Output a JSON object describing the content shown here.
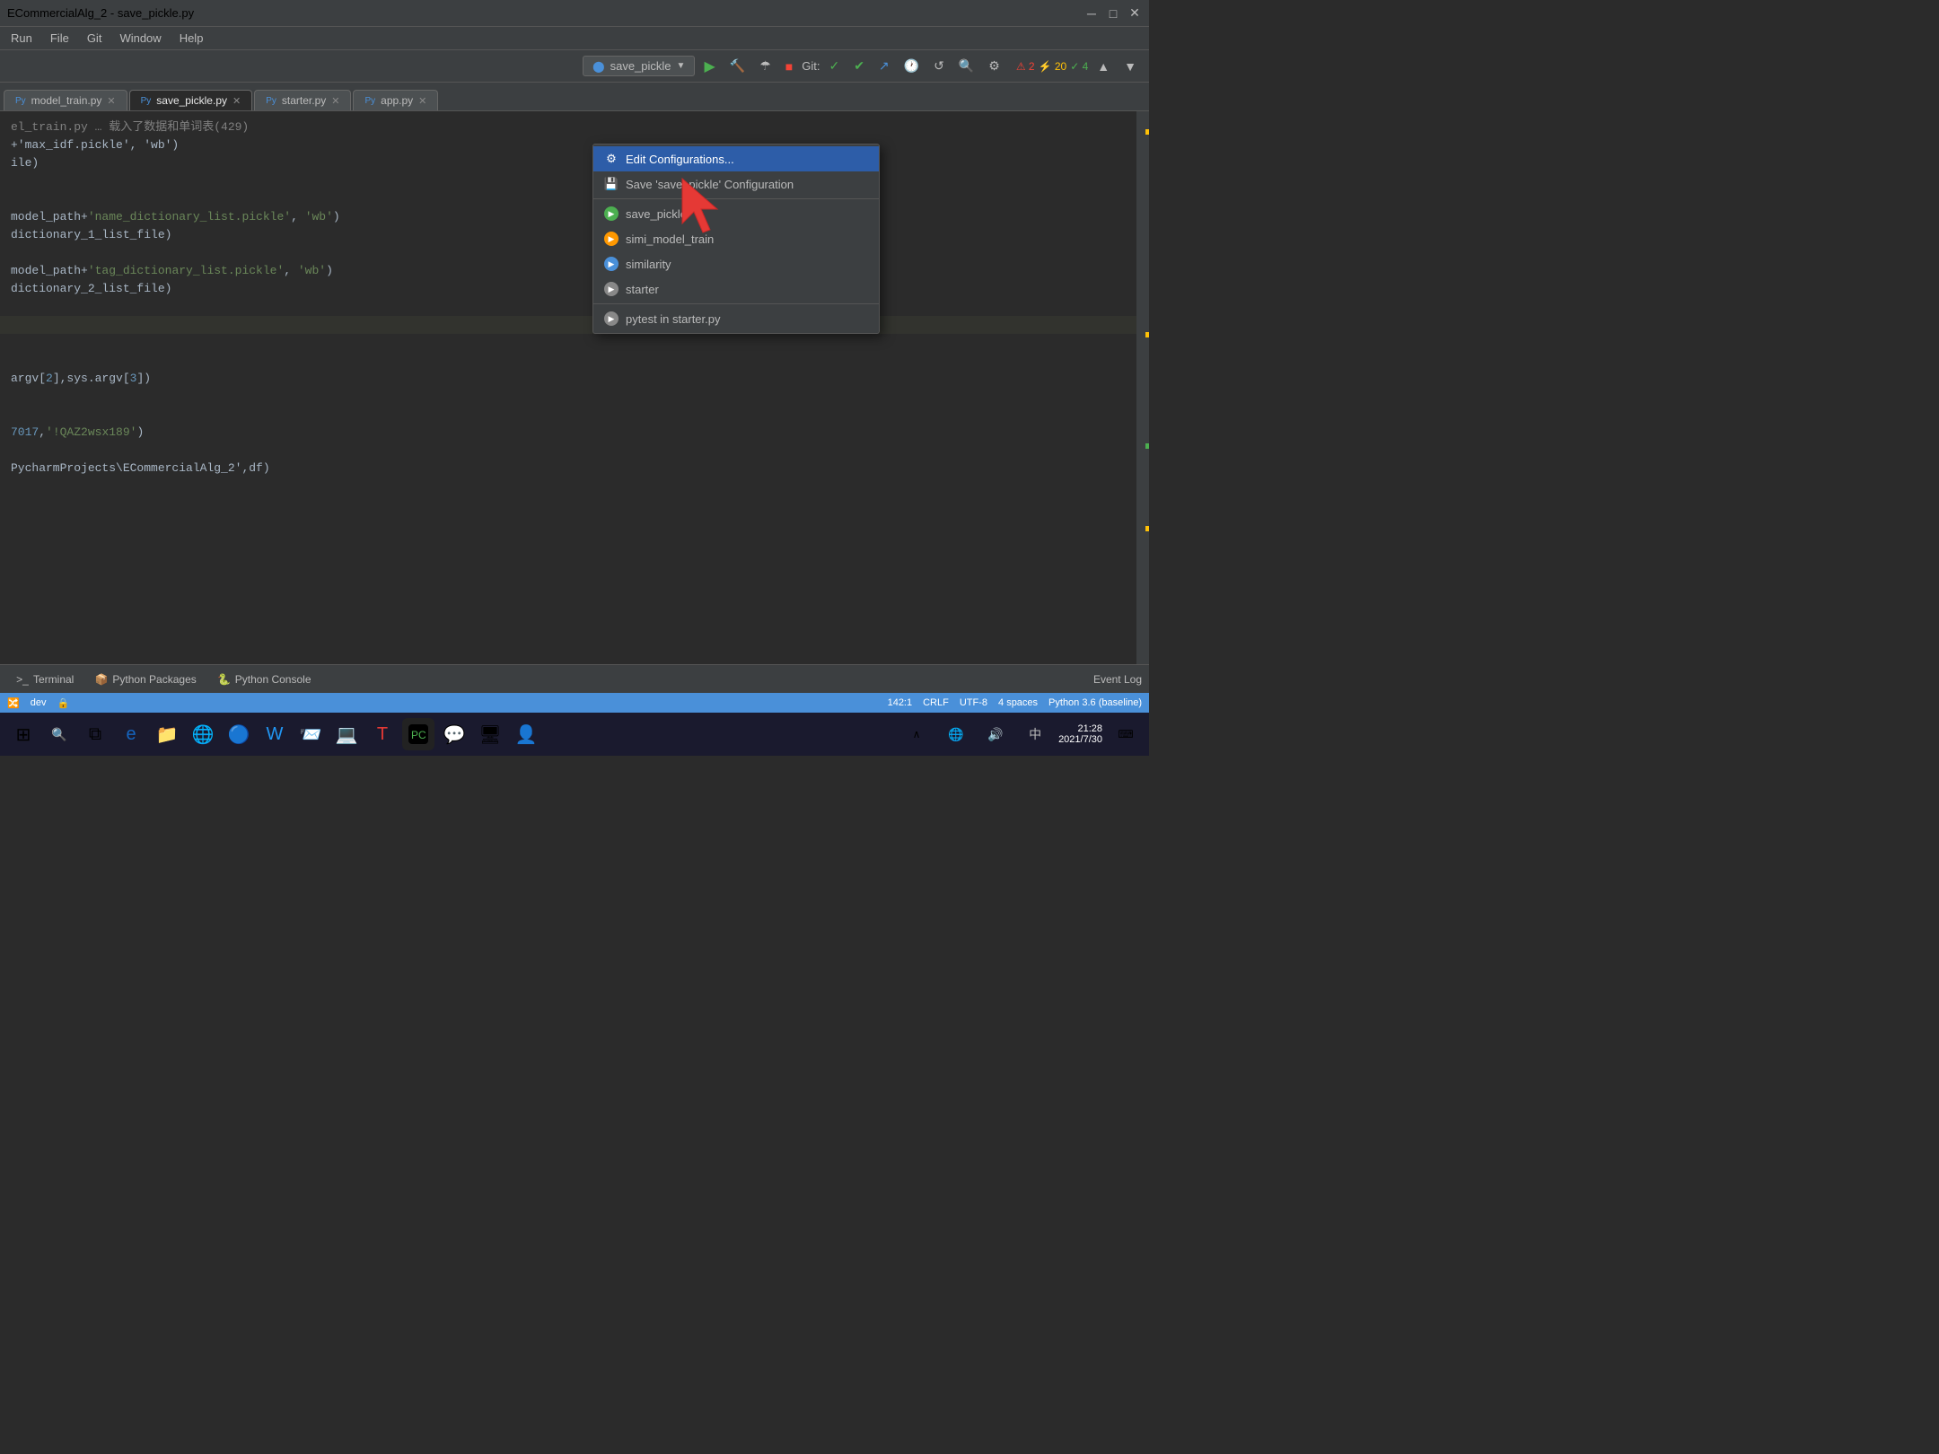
{
  "window": {
    "title": "ECommercialAlg_2 - save_pickle.py",
    "tab_title": "save_pickle.py"
  },
  "menu": {
    "items": [
      "Run",
      "File",
      "Git",
      "Window",
      "Help"
    ]
  },
  "toolbar": {
    "run_config": "save_pickle",
    "git_label": "Git:",
    "warnings": "⚠ 2",
    "errors": "⚡ 20",
    "ok": "✓ 4"
  },
  "tabs": [
    {
      "label": "model_train.py",
      "closable": true
    },
    {
      "label": "save_pickle.py",
      "closable": true,
      "active": true
    },
    {
      "label": "starter.py",
      "closable": true
    },
    {
      "label": "app.py",
      "closable": true
    }
  ],
  "dropdown": {
    "items": [
      {
        "type": "action",
        "label": "Edit Configurations...",
        "icon": "gear",
        "selected": true
      },
      {
        "type": "action",
        "label": "Save 'save_pickle' Configuration",
        "icon": "save"
      },
      {
        "type": "divider"
      },
      {
        "type": "config",
        "label": "save_pickle",
        "icon": "run-green"
      },
      {
        "type": "config",
        "label": "simi_model_train",
        "icon": "run-orange"
      },
      {
        "type": "config",
        "label": "similarity",
        "icon": "run-blue"
      },
      {
        "type": "config",
        "label": "starter",
        "icon": "run-grey"
      },
      {
        "type": "divider"
      },
      {
        "type": "config",
        "label": "pytest in starter.py",
        "icon": "run-grey"
      }
    ]
  },
  "code_lines": [
    {
      "content": "el_train.py … 载入了数据和单词表(429)",
      "highlighted": false
    },
    {
      "content": "+'max_idf.pickle', 'wb')",
      "highlighted": false
    },
    {
      "content": "ile)",
      "highlighted": false
    },
    {
      "content": "",
      "highlighted": false
    },
    {
      "content": "",
      "highlighted": false
    },
    {
      "content": "model_path+'name_dictionary_list.pickle', 'wb')",
      "highlighted": false
    },
    {
      "content": "dictionary_1_list_file)",
      "highlighted": false
    },
    {
      "content": "",
      "highlighted": false
    },
    {
      "content": "model_path+'tag_dictionary_list.pickle', 'wb')",
      "highlighted": false
    },
    {
      "content": "dictionary_2_list_file)",
      "highlighted": false
    },
    {
      "content": "",
      "highlighted": false
    },
    {
      "content": "",
      "highlighted": true
    },
    {
      "content": "",
      "highlighted": false
    },
    {
      "content": "",
      "highlighted": false
    },
    {
      "content": "argv[2],sys.argv[3])",
      "highlighted": false
    },
    {
      "content": "",
      "highlighted": false
    },
    {
      "content": "",
      "highlighted": false
    },
    {
      "content": "7017,'!QAZ2wsx189')",
      "highlighted": false
    },
    {
      "content": "",
      "highlighted": false
    },
    {
      "content": "PycharmProjects\\ECommercialAlg_2',df)",
      "highlighted": false
    }
  ],
  "bottom_tabs": [
    {
      "label": "Terminal",
      "icon": ">_"
    },
    {
      "label": "Python Packages",
      "icon": "📦"
    },
    {
      "label": "Python Console",
      "icon": "🐍"
    }
  ],
  "status_bar": {
    "position": "142:1",
    "line_ending": "CRLF",
    "encoding": "UTF-8",
    "indent": "4 spaces",
    "interpreter": "Python 3.6 (baseline)",
    "branch": "dev",
    "event_log": "Event Log"
  },
  "taskbar": {
    "time": "21:28",
    "date": "2021/7/30"
  }
}
